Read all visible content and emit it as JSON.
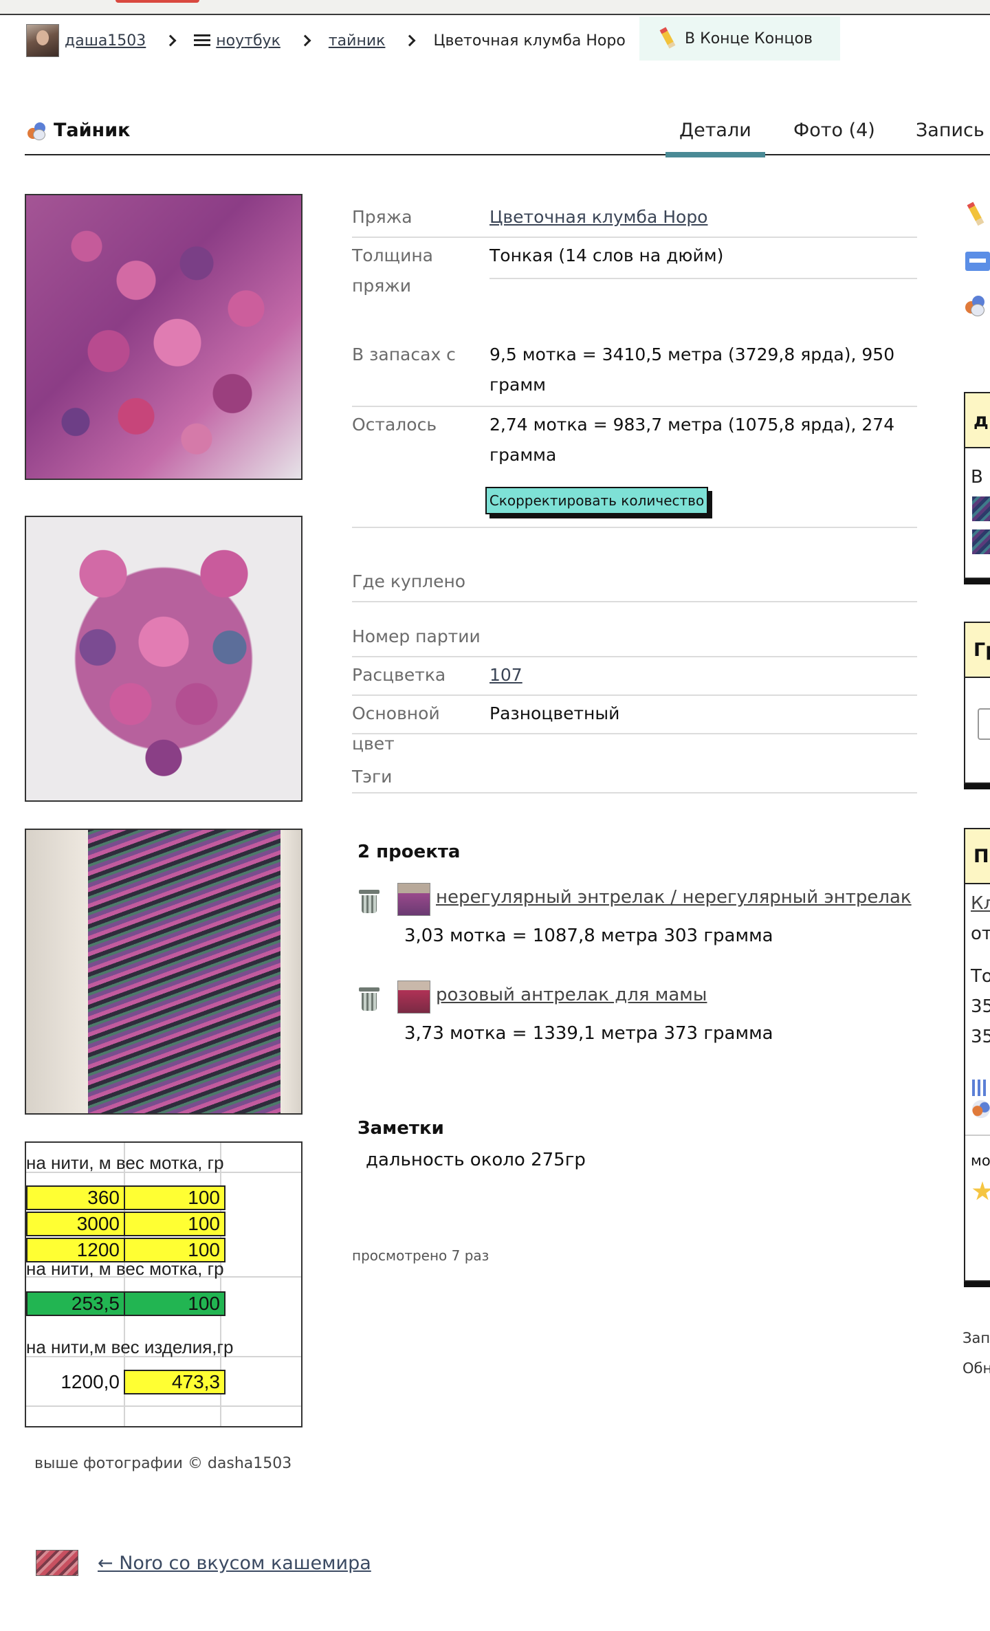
{
  "breadcrumb": {
    "user": "даша1503",
    "notebook": "ноутбук",
    "stash": "тайник",
    "current": "Цветочная клумба Норо",
    "tag_button": "В Конце Концов"
  },
  "header": {
    "title": "Тайник",
    "tabs": [
      "Детали",
      "Фото (4)",
      "Запись Б"
    ]
  },
  "photos": {
    "credit": "выше фотографии © dasha1503",
    "spreadsheet": {
      "header1": "на нити, м  вес мотка, гр",
      "rows1": [
        [
          "360",
          "100"
        ],
        [
          "3000",
          "100"
        ],
        [
          "1200",
          "100"
        ]
      ],
      "header2": "на нити, м  вес мотка, гр",
      "row2": [
        "253,5",
        "100"
      ],
      "header3": "на нити,м   вес изделия,гр",
      "row3": [
        "1200,0",
        "473,3"
      ]
    }
  },
  "details": {
    "yarn_label": "Пряжа",
    "yarn_value": "Цветочная клумба Норо",
    "weight_label": "Толщина пряжи",
    "weight_value": "Тонкая (14 слов на дюйм)",
    "stash_label": "В запасах с",
    "stash_value": "9,5 мотка = 3410,5 метра (3729,8 ярда), 950 грамм",
    "left_label": "Осталось",
    "left_value": "2,74 мотка = 983,7 метра (1075,8 ярда), 274 грамма",
    "adjust_button": "Скорректировать количество",
    "bought_label": "Где куплено",
    "lot_label": "Номер партии",
    "color_label": "Расцветка",
    "color_value": "107",
    "main_color_label": "Основной цвет",
    "main_color_value": "Разноцветный",
    "tags_label": "Тэги"
  },
  "projects": {
    "heading": "2 проекта",
    "items": [
      {
        "name": "нерегулярный энтрелак / нерегулярный энтрелак",
        "amount": "3,03 мотка = 1087,8 метра 303 грамма"
      },
      {
        "name": "розовый антрелак для мамы",
        "amount": "3,73 мотка = 1339,1 метра 373 грамма"
      }
    ]
  },
  "notes": {
    "heading": "Заметки",
    "text": "дальность около 275гр"
  },
  "views": "просмотрено 7 раз",
  "prev_link": "← Noro со вкусом кашемира",
  "rail": {
    "box1_head": "ды",
    "box1_text": "В",
    "box2_head": "Гр",
    "box3_head": "Пр",
    "box3_lines": [
      "Кл",
      "от",
      "То",
      "35",
      "35"
    ],
    "box3_footer": "мо",
    "meta1": "Зап",
    "meta2": "Обн"
  }
}
